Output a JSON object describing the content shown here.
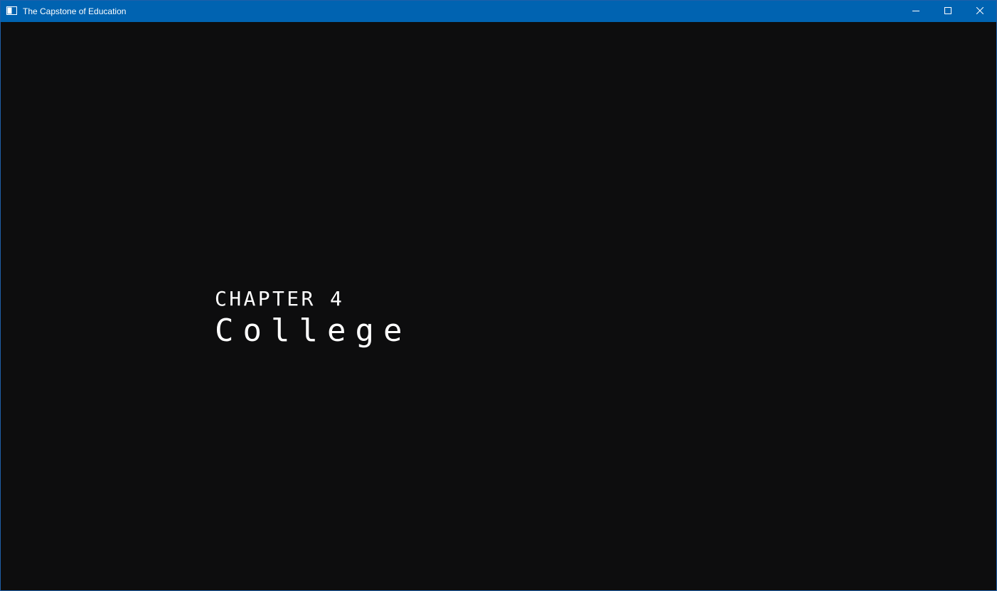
{
  "window": {
    "title": "The Capstone of Education",
    "icon": "app-window-icon",
    "controls": {
      "minimize_icon": "minimize-icon",
      "maximize_icon": "maximize-icon",
      "close_icon": "close-icon"
    },
    "colors": {
      "titlebar": "#0063b1",
      "background": "#0d0d0e",
      "text": "#ffffff"
    }
  },
  "screen": {
    "chapter_label": "CHAPTER 4",
    "chapter_title": "College"
  }
}
